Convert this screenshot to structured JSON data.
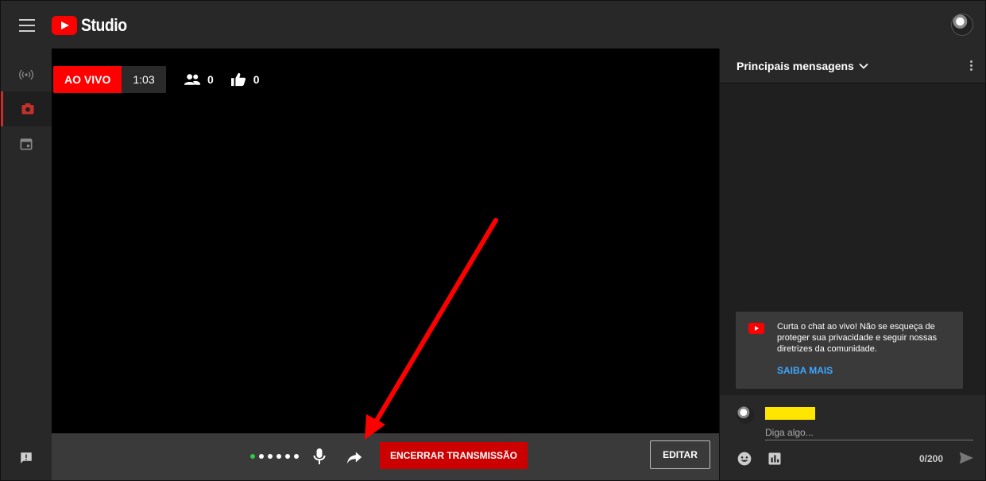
{
  "app": {
    "logo_text": "Studio"
  },
  "live": {
    "label": "AO VIVO",
    "elapsed": "1:03",
    "viewers": "0",
    "likes": "0"
  },
  "controls": {
    "end_label": "ENCERRAR TRANSMISSÃO",
    "edit_label": "EDITAR"
  },
  "chat": {
    "title": "Principais mensagens",
    "notice_text": "Curta o chat ao vivo! Não se esqueça de proteger sua privacidade e seguir nossas diretrizes da comunidade.",
    "notice_link": "SAIBA MAIS",
    "placeholder": "Diga algo...",
    "char_count": "0/200"
  },
  "colors": {
    "accent": "#ff0000",
    "end_button": "#cc0000",
    "link": "#3ea6ff",
    "highlight": "#ffe600",
    "annotation": "#ff0000"
  },
  "icons": {
    "menu": "hamburger-menu-icon",
    "rail": [
      "live-broadcast-icon",
      "camera-icon",
      "calendar-icon"
    ],
    "feedback": "feedback-icon"
  }
}
